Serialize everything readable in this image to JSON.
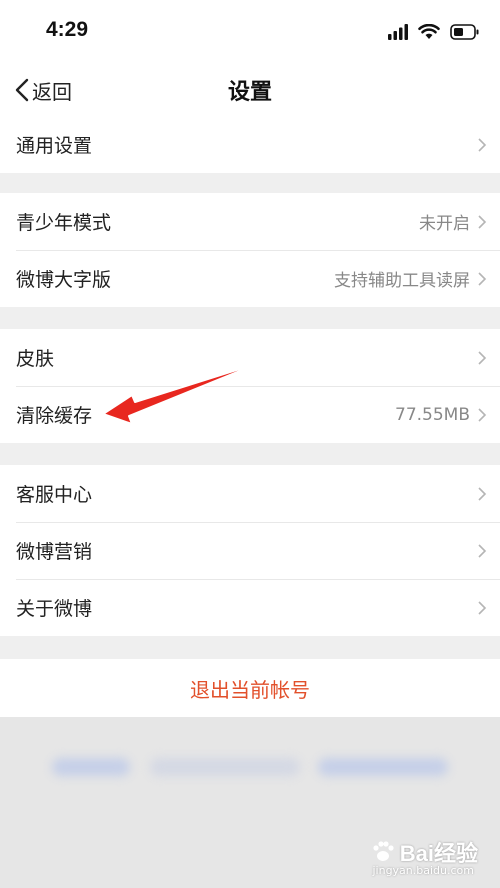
{
  "status_bar": {
    "time": "4:29"
  },
  "nav": {
    "back_label": "返回",
    "title": "设置"
  },
  "groups": [
    {
      "items": [
        {
          "label": "通用设置",
          "value": ""
        }
      ]
    },
    {
      "items": [
        {
          "label": "青少年模式",
          "value": "未开启"
        },
        {
          "label": "微博大字版",
          "value": "支持辅助工具读屏"
        }
      ]
    },
    {
      "items": [
        {
          "label": "皮肤",
          "value": ""
        },
        {
          "label": "清除缓存",
          "value": "77.55MB"
        }
      ]
    },
    {
      "items": [
        {
          "label": "客服中心",
          "value": ""
        },
        {
          "label": "微博营销",
          "value": ""
        },
        {
          "label": "关于微博",
          "value": ""
        }
      ]
    }
  ],
  "logout": {
    "label": "退出当前帐号"
  },
  "annotation": {
    "arrow_color": "#e8271f"
  },
  "watermark": {
    "text": "Bai经验",
    "sub": "jingyan.baidu.com"
  },
  "colors": {
    "accent": "#e2502b",
    "background": "#efefef",
    "value_text": "#888888"
  }
}
